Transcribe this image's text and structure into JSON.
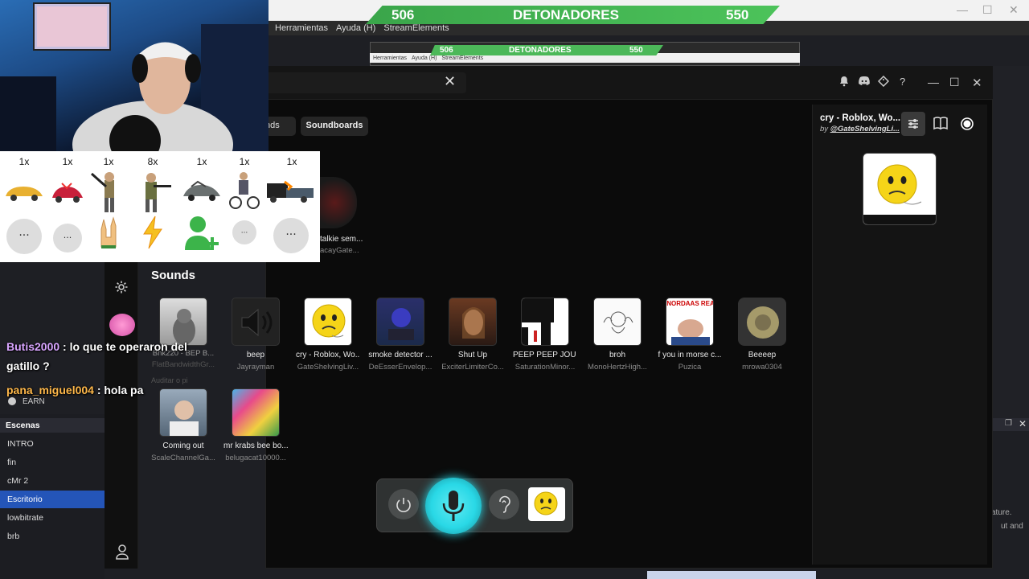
{
  "obs": {
    "menu": [
      "Herramientas",
      "Ayuda (H)",
      "StreamElements"
    ],
    "nested_menu": [
      "Herramientas",
      "Ayuda (H)",
      "StreamElements"
    ],
    "earn_label": "EARN",
    "scenes_header": "Escenas",
    "scenes": [
      "INTRO",
      "fin",
      "cMr 2",
      "Escritorio",
      "lowbitrate",
      "brb"
    ],
    "active_scene": "Escritorio",
    "right_text_1": "ature.",
    "right_text_2": "ut and"
  },
  "detonadores": {
    "left": "506",
    "label": "DETONADORES",
    "right": "550"
  },
  "voicemod": {
    "tabs": [
      "nds",
      "Soundboards"
    ],
    "partial_tile": {
      "name": "talkie sem...",
      "author": "acayGate..."
    },
    "sounds_title": "Sounds",
    "sounds": [
      {
        "name": "",
        "author": "Bhk220 - BEP B...",
        "author2": "FlatBandwidthGr..."
      },
      {
        "name": "beep",
        "author": "Jayrayman"
      },
      {
        "name": "cry - Roblox, Wo...",
        "author": "GateShelvingLiv..."
      },
      {
        "name": "smoke detector ...",
        "author": "DeEsserEnvelop..."
      },
      {
        "name": "Shut Up",
        "author": "ExciterLimiterCo..."
      },
      {
        "name": "PEEP PEEP JOU ...",
        "author": "SaturationMinor..."
      },
      {
        "name": "broh",
        "author": "MonoHertzHigh..."
      },
      {
        "name": "f you in morse c...",
        "author": "Puzica"
      },
      {
        "name": "Beeeep",
        "author": "mrowa0304"
      },
      {
        "name": "Coming out",
        "author": "ScaleChannelGa..."
      },
      {
        "name": "mr krabs bee bo...",
        "author": "belugacat10000..."
      }
    ],
    "thumb_text_morse": "NORDAAS REA",
    "now_playing": {
      "title": "cry - Roblox, Wo...",
      "by": "by",
      "author": "@GateShelvingLi..."
    }
  },
  "detonators_panel": {
    "counts": [
      "1x",
      "1x",
      "1x",
      "8x",
      "1x",
      "1x",
      "1x"
    ],
    "items": [
      "yellow-sports-car",
      "red-crashed-car",
      "bat-man",
      "soldier-rifle",
      "wrecked-car",
      "motorcycle-rider",
      "truck-crash"
    ],
    "reactions": [
      "...",
      "...",
      "rock-hand",
      "lightning",
      "add-user",
      "...",
      "..."
    ]
  },
  "chat": [
    {
      "user": "Butis2000",
      "message": ": lo que te operaron del",
      "message2": "gatillo ?",
      "color": "#d8a5ff"
    },
    {
      "user": "pana_miguel004",
      "message": ": hola pa",
      "color": "#ffb84a"
    }
  ],
  "chat_ghost": "Auditar o pi",
  "colors": {
    "accent_green": "#4cc35a",
    "scene_active": "#2455b8",
    "mic_glow": "#29d8e6"
  }
}
